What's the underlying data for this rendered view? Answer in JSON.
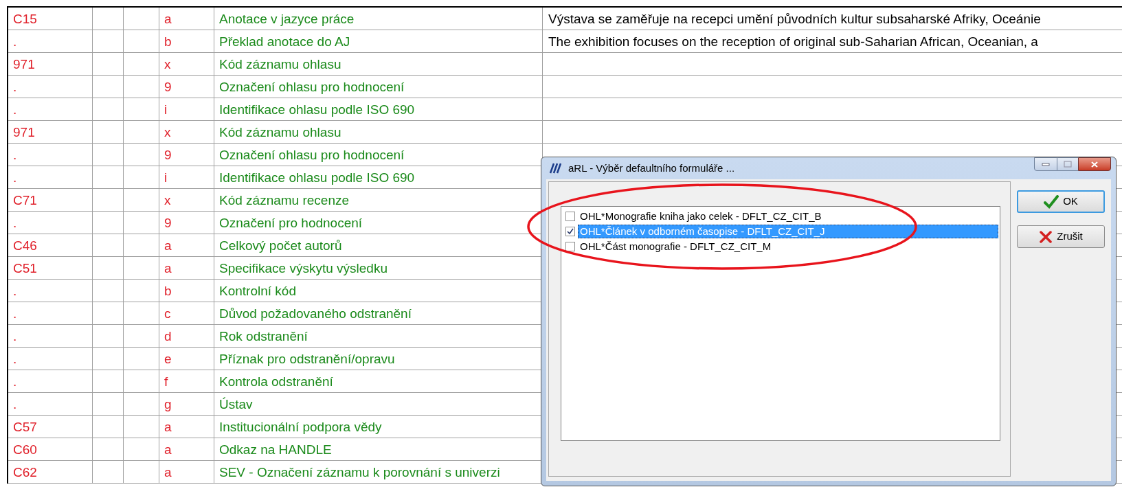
{
  "table": {
    "rows": [
      {
        "tag": "C15",
        "code": "a",
        "label": "Anotace v jazyce práce",
        "value": "Výstava se zaměřuje na recepci umění původních kultur subsaharské Afriky, Oceánie"
      },
      {
        "tag": ".",
        "code": "b",
        "label": "Překlad anotace do AJ",
        "value": "The exhibition focuses on the reception of original sub-Saharian African, Oceanian, a"
      },
      {
        "tag": "971",
        "code": "x",
        "label": "Kód záznamu ohlasu"
      },
      {
        "tag": ".",
        "code": "9",
        "label": "Označení ohlasu pro hodnocení"
      },
      {
        "tag": ".",
        "code": "i",
        "label": "Identifikace ohlasu podle ISO 690"
      },
      {
        "tag": "971",
        "code": "x",
        "label": "Kód záznamu ohlasu"
      },
      {
        "tag": ".",
        "code": "9",
        "label": "Označení ohlasu pro hodnocení"
      },
      {
        "tag": ".",
        "code": "i",
        "label": "Identifikace ohlasu podle ISO 690"
      },
      {
        "tag": "C71",
        "code": "x",
        "label": "Kód záznamu recenze"
      },
      {
        "tag": ".",
        "code": "9",
        "label": "Označení pro hodnocení"
      },
      {
        "tag": "C46",
        "code": "a",
        "label": "Celkový počet autorů"
      },
      {
        "tag": "C51",
        "code": "a",
        "label": "Specifikace výskytu výsledku"
      },
      {
        "tag": ".",
        "code": "b",
        "label": "Kontrolní kód"
      },
      {
        "tag": ".",
        "code": "c",
        "label": "Důvod požadovaného odstranění"
      },
      {
        "tag": ".",
        "code": "d",
        "label": "Rok odstranění"
      },
      {
        "tag": ".",
        "code": "e",
        "label": "Příznak pro odstranění/opravu"
      },
      {
        "tag": ".",
        "code": "f",
        "label": "Kontrola odstranění"
      },
      {
        "tag": ".",
        "code": "g",
        "label": "Ústav"
      },
      {
        "tag": "C57",
        "code": "a",
        "label": "Institucionální podpora vědy"
      },
      {
        "tag": "C60",
        "code": "a",
        "label": "Odkaz na HANDLE"
      },
      {
        "tag": "C62",
        "code": "a",
        "label": "SEV - Označení záznamu k porovnání s univerzi"
      }
    ]
  },
  "dialog": {
    "title": "aRL - Výběr defaultního formuláře ...",
    "items": [
      {
        "label": "OHL*Monografie kniha jako celek - DFLT_CZ_CIT_B",
        "checked": false,
        "selected": false
      },
      {
        "label": "OHL*Článek v odborném časopise - DFLT_CZ_CIT_J",
        "checked": true,
        "selected": true
      },
      {
        "label": "OHL*Část monografie - DFLT_CZ_CIT_M",
        "checked": false,
        "selected": false
      }
    ],
    "buttons": [
      {
        "kind": "ok",
        "label": "OK"
      },
      {
        "kind": "cancel",
        "label": "Zrušit"
      }
    ]
  }
}
